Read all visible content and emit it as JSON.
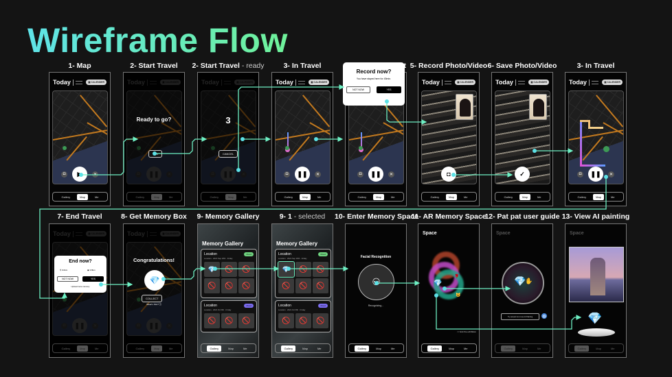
{
  "title": "Wireframe Flow",
  "colors": {
    "accent_line": "#6ef0c4",
    "dot": "#5ce1e6",
    "title_from": "#5fe3e8",
    "title_to": "#6ff29a"
  },
  "common": {
    "today": "Today",
    "calendar": "CALENDER",
    "nav": [
      "Gallery",
      "Map",
      "Me"
    ]
  },
  "screens": [
    {
      "title": "1- Map",
      "type": "map",
      "row": 0,
      "col": 0,
      "nav": 1,
      "btn": "play"
    },
    {
      "title": "2- Start Travel",
      "type": "start",
      "row": 0,
      "col": 1,
      "nav": 1,
      "text": "Ready to go?",
      "button": "YES"
    },
    {
      "title": "2- Start Travel",
      "title_suffix": " - ready",
      "type": "ready",
      "row": 0,
      "col": 2,
      "nav": 1,
      "text": "3",
      "button": "CANCEL"
    },
    {
      "title": "3- In Travel",
      "type": "travel",
      "row": 0,
      "col": 3,
      "nav": 1
    },
    {
      "title": "4- Record Prompt",
      "type": "prompt",
      "row": 0,
      "col": 4,
      "nav": 1,
      "heading": "Record now?",
      "message": "You have stayed here for 45min.",
      "no": "NOT NOW",
      "yes": "YES"
    },
    {
      "title": "5- Record Photo/Video",
      "type": "photo",
      "row": 0,
      "col": 5,
      "nav": 1,
      "btn": "camera"
    },
    {
      "title": "6- Save Photo/Video",
      "type": "photo",
      "row": 0,
      "col": 6,
      "nav": 1,
      "btn": "check"
    },
    {
      "title": "3- In Travel",
      "type": "route",
      "row": 0,
      "col": 7,
      "nav": 1
    },
    {
      "title": "7- End Travel",
      "type": "end",
      "row": 1,
      "col": 0,
      "nav": 1,
      "heading": "End now?",
      "stat1": "9.0km",
      "stat2": "3.8km",
      "no": "NOT NOW",
      "yes": "YES",
      "link": "Upload more memory"
    },
    {
      "title": "8- Get Memory Box",
      "type": "box",
      "row": 1,
      "col": 1,
      "nav": 1,
      "heading": "Congratulations!",
      "button": "COLLECT",
      "link": "What's this? ⓘ"
    },
    {
      "title": "9- Memory Gallery",
      "type": "gallery",
      "row": 1,
      "col": 2,
      "nav": 0,
      "heading": "Memory Gallery",
      "cards": [
        {
          "label": "Location",
          "date": "Location · 2021 Sep 18th · Friday",
          "badge": "Mood",
          "color": "#6fd37f"
        },
        {
          "label": "Location",
          "date": "Location · 2021 Oct 8th · Friday",
          "badge": "Mood",
          "color": "#7b6cf0"
        }
      ]
    },
    {
      "title": "9- 1",
      "title_suffix": " - selected",
      "type": "gallery",
      "selected": true,
      "row": 1,
      "col": 3,
      "nav": 0,
      "heading": "Memory Gallery",
      "cards": [
        {
          "label": "Location",
          "date": "Location · 2021 Sep 18th · Friday",
          "badge": "Mood",
          "color": "#6fd37f"
        },
        {
          "label": "Location",
          "date": "Location · 2021 Oct 8th · Friday",
          "badge": "Mood",
          "color": "#7b6cf0"
        }
      ]
    },
    {
      "title": "10- Enter Memory Space",
      "type": "face",
      "row": 1,
      "col": 4,
      "nav": 0,
      "heading": "Facial Recognition",
      "status": "Recognizing..."
    },
    {
      "title": "11- AR Memory Space",
      "type": "ar",
      "row": 1,
      "col": 5,
      "nav": 0,
      "heading": "Space",
      "exit": "<< Exit the exhibition"
    },
    {
      "title": "12- Pat pat user guide",
      "type": "pat",
      "row": 1,
      "col": 6,
      "nav": 0,
      "heading": "Space",
      "hint": "Try pat pat me to see AI Painting"
    },
    {
      "title": "13- View AI painting",
      "type": "painting",
      "row": 1,
      "col": 7,
      "nav": 0,
      "heading": "Space"
    }
  ]
}
